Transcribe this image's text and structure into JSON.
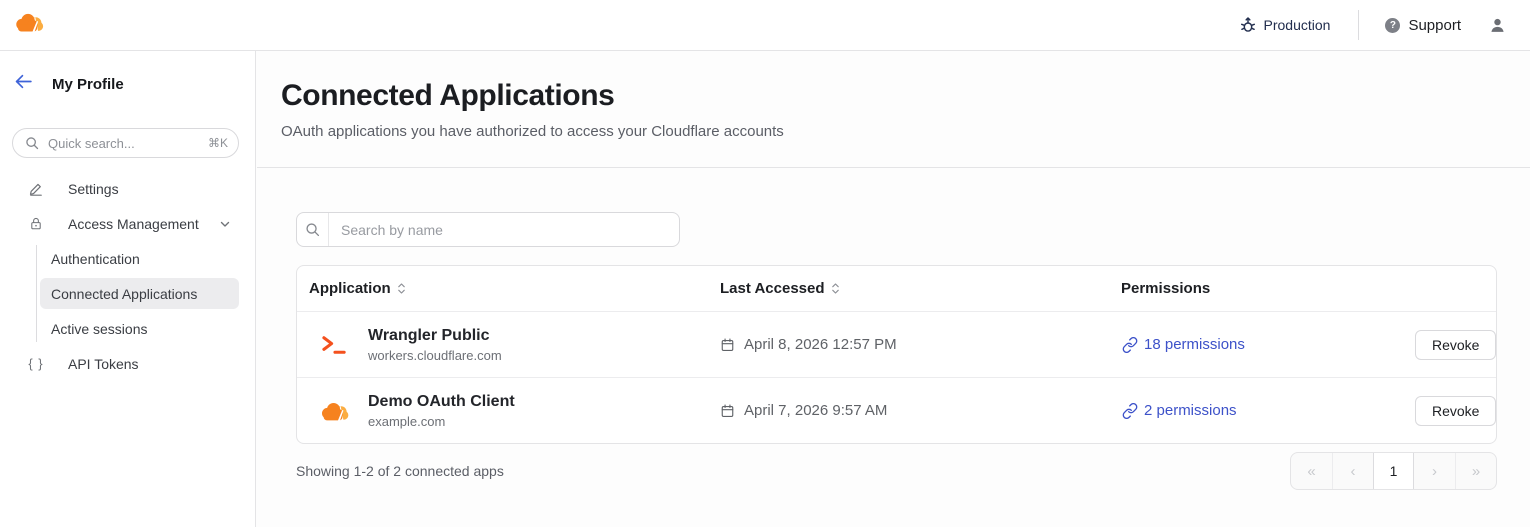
{
  "topbar": {
    "environment": "Production",
    "support_label": "Support"
  },
  "sidebar": {
    "title": "My Profile",
    "search": {
      "placeholder": "Quick search...",
      "shortcut": "⌘K"
    },
    "items": [
      {
        "label": "Settings"
      },
      {
        "label": "Access Management"
      },
      {
        "label": "Authentication"
      },
      {
        "label": "Connected Applications"
      },
      {
        "label": "Active sessions"
      },
      {
        "label": "API Tokens"
      }
    ],
    "braces_glyph": "{ }"
  },
  "main": {
    "title": "Connected Applications",
    "subtitle": "OAuth applications you have authorized to access your Cloudflare accounts",
    "search_placeholder": "Search by name",
    "table": {
      "columns": [
        "Application",
        "Last Accessed",
        "Permissions"
      ],
      "rows": [
        {
          "app": "Wrangler Public",
          "domain": "workers.cloudflare.com",
          "icon": "terminal-icon",
          "last_accessed": "April 8, 2026 12:57 PM",
          "permissions": "18 permissions",
          "action": "Revoke"
        },
        {
          "app": "Demo OAuth Client",
          "domain": "example.com",
          "icon": "cloudflare-icon",
          "last_accessed": "April 7, 2026 9:57 AM",
          "permissions": "2 permissions",
          "action": "Revoke"
        }
      ]
    },
    "footer": {
      "summary": "Showing 1-2 of 2 connected apps",
      "page": "1",
      "first": "«",
      "prev": "‹",
      "next": "›",
      "last": "»"
    }
  },
  "colors": {
    "accent_blue": "#3d52c9",
    "cloudflare_orange": "#f6821f",
    "cloudflare_light_orange": "#fbad41",
    "wrangler_orange": "#f4511e",
    "border": "#e4e4e6",
    "selected_bg": "#ececee"
  }
}
